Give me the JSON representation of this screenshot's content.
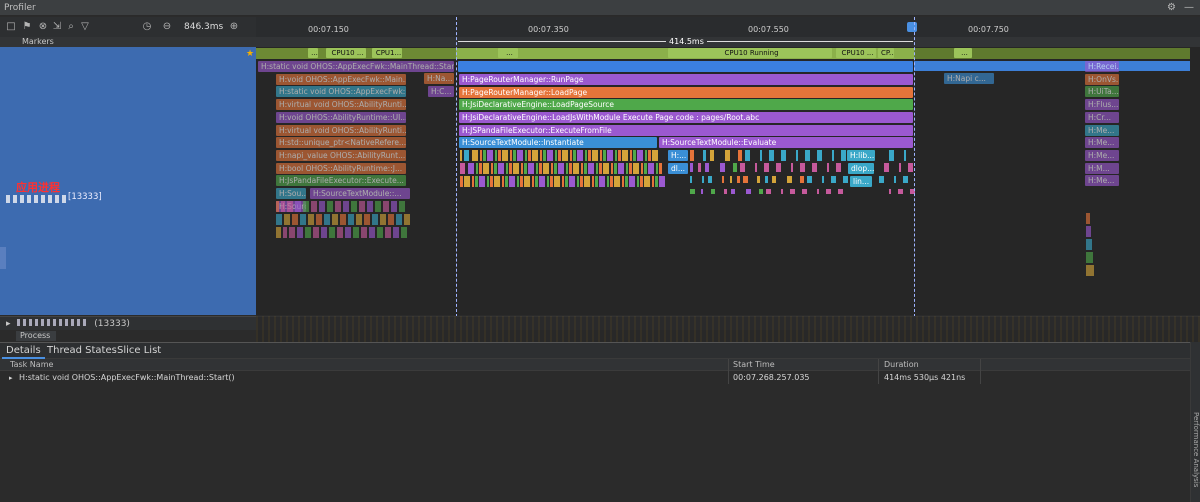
{
  "window": {
    "title": "Profiler"
  },
  "toolbar": {
    "duration": "846.3ms"
  },
  "ruler": {
    "ticks": [
      "00:07.150",
      "00:07.350",
      "00:07.550",
      "00:07.750"
    ],
    "selection": "414.5ms"
  },
  "markers": {
    "label": "Markers"
  },
  "process": {
    "annotation": "应用进程",
    "pid_label": "[13333]",
    "row_label": "(13333)",
    "process_tab": "Process"
  },
  "cpu": {
    "left_labels": [
      "...",
      "CPU10 ...",
      "CPU1..."
    ],
    "main": "CPU10 Running",
    "right_labels": [
      "CPU10 ...",
      "CP...",
      "C..."
    ],
    "far_labels": [
      "...",
      "...",
      "..."
    ]
  },
  "left_slices": [
    "H:static void OHOS::AppExecFwk::MainThread::Start()",
    "H:void OHOS::AppExecFwk::Main...",
    "H:static void OHOS::AppExecFwk::...",
    "H:virtual void OHOS::AbilityRunti...",
    "H:void OHOS::AbilityRuntime::UI...",
    "H:virtual void OHOS::AbilityRunti...",
    "H:std::unique_ptr<NativeRefere...",
    "H:napi_value OHOS::AbilityRunt...",
    "H:bool OHOS::AbilityRuntime::J...",
    "H:JsPandaFileExecutor::Execute...",
    "H:Sou...",
    "H:SourceTextModule::..."
  ],
  "mid_small": [
    "H:Na...",
    "H:C..."
  ],
  "main_slices": [
    "H:PageRouterManager::RunPage",
    "H:PageRouterManager::LoadPage",
    "H:JsiDeclarativeEngine::LoadPageSource",
    "H:JsiDeclarativeEngine::LoadJsWithModule Execute Page code : pages/Root.abc",
    "H:JSPandaFileExecutor::ExecuteFromFile",
    "H:SourceTextModule::Instantiate",
    "H:SourceTextModule::Evaluate"
  ],
  "eval_children": [
    "H:...",
    "dl...",
    "H:lib...",
    "dlop...",
    "lin..."
  ],
  "right_slices": [
    "H:Napi c...",
    "H:Recei...",
    "H:OnVs...",
    "H:UiTa...",
    "H:Flus...",
    "H:Cr...",
    "H:Me...",
    "H:Me...",
    "H:Me...",
    "H:M...",
    "H:Me..."
  ],
  "details": {
    "tabs": [
      "Details",
      "Thread States",
      "Slice List"
    ],
    "columns": [
      "Task Name",
      "Start Time",
      "Duration"
    ],
    "rows": [
      {
        "task": "H:static void OHOS::AppExecFwk::MainThread::Start()",
        "start": "00:07.268.257.035",
        "duration": "414ms 530μs 421ns"
      }
    ]
  },
  "side_label": "Performance Analysis",
  "colors": {
    "purple": "#9b59d0",
    "orange": "#e5743a",
    "green": "#4fa84a",
    "blue": "#3a8fd6",
    "cyan": "#3aa8c8",
    "selection_blue": "#3b7fe0",
    "process_panel": "#3d6bb0"
  }
}
